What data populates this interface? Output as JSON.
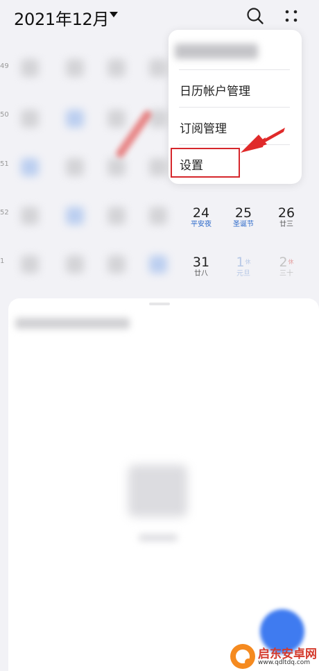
{
  "header": {
    "month_title": "2021年12月"
  },
  "week_numbers": [
    "49",
    "50",
    "51",
    "52",
    "1"
  ],
  "dates": [
    {
      "num": "24",
      "sub": "平安夜",
      "style": "blue"
    },
    {
      "num": "25",
      "sub": "圣诞节",
      "style": "blue"
    },
    {
      "num": "26",
      "sub": "廿三",
      "style": "normal"
    },
    {
      "num": "31",
      "sub": "廿八",
      "style": "normal"
    },
    {
      "num": "1",
      "badge": "休",
      "sub": "元旦",
      "style": "dim"
    },
    {
      "num": "2",
      "badge": "休",
      "sub": "三十",
      "style": "dim2"
    }
  ],
  "menu": {
    "items": [
      "日历帐户管理",
      "订阅管理",
      "设置"
    ]
  },
  "watermark": {
    "title": "启东安卓网",
    "url": "www.qdltdq.com"
  },
  "colors": {
    "accent_blue": "#2a68c9",
    "highlight_red": "#d6262b",
    "fab_blue": "#3f7bf0"
  },
  "icons": {
    "search": "search-icon",
    "more": "more-dots-icon",
    "dropdown": "caret-down-icon"
  }
}
